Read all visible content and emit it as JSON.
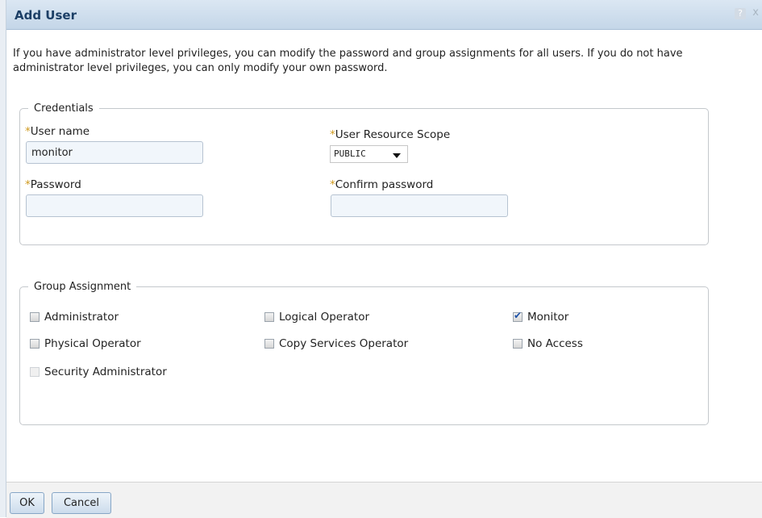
{
  "dialog": {
    "title": "Add User",
    "help_icon": "?",
    "close_icon": "x",
    "intro": "If you have administrator level privileges, you can modify the password and group assignments for all users. If you do not have administrator level privileges, you can only modify your own password."
  },
  "credentials": {
    "legend": "Credentials",
    "required_marker": "*",
    "user_name": {
      "label": "User name",
      "value": "monitor"
    },
    "resource_scope": {
      "label": "User Resource Scope",
      "value": "PUBLIC"
    },
    "password": {
      "label": "Password",
      "value": ""
    },
    "confirm_password": {
      "label": "Confirm password",
      "value": ""
    }
  },
  "group_assignment": {
    "legend": "Group Assignment",
    "options": [
      {
        "label": "Administrator",
        "checked": false,
        "enabled": true
      },
      {
        "label": "Logical Operator",
        "checked": false,
        "enabled": true
      },
      {
        "label": "Monitor",
        "checked": true,
        "enabled": true
      },
      {
        "label": "Physical Operator",
        "checked": false,
        "enabled": true
      },
      {
        "label": "Copy Services Operator",
        "checked": false,
        "enabled": true
      },
      {
        "label": "No Access",
        "checked": false,
        "enabled": true
      },
      {
        "label": "Security Administrator",
        "checked": false,
        "enabled": false
      }
    ]
  },
  "footer": {
    "ok_label": "OK",
    "cancel_label": "Cancel"
  },
  "colors": {
    "title_text": "#1c3f66",
    "required_marker": "#d09a1e",
    "input_bg": "#f1f6fb",
    "check_mark": "#1e52a8"
  }
}
